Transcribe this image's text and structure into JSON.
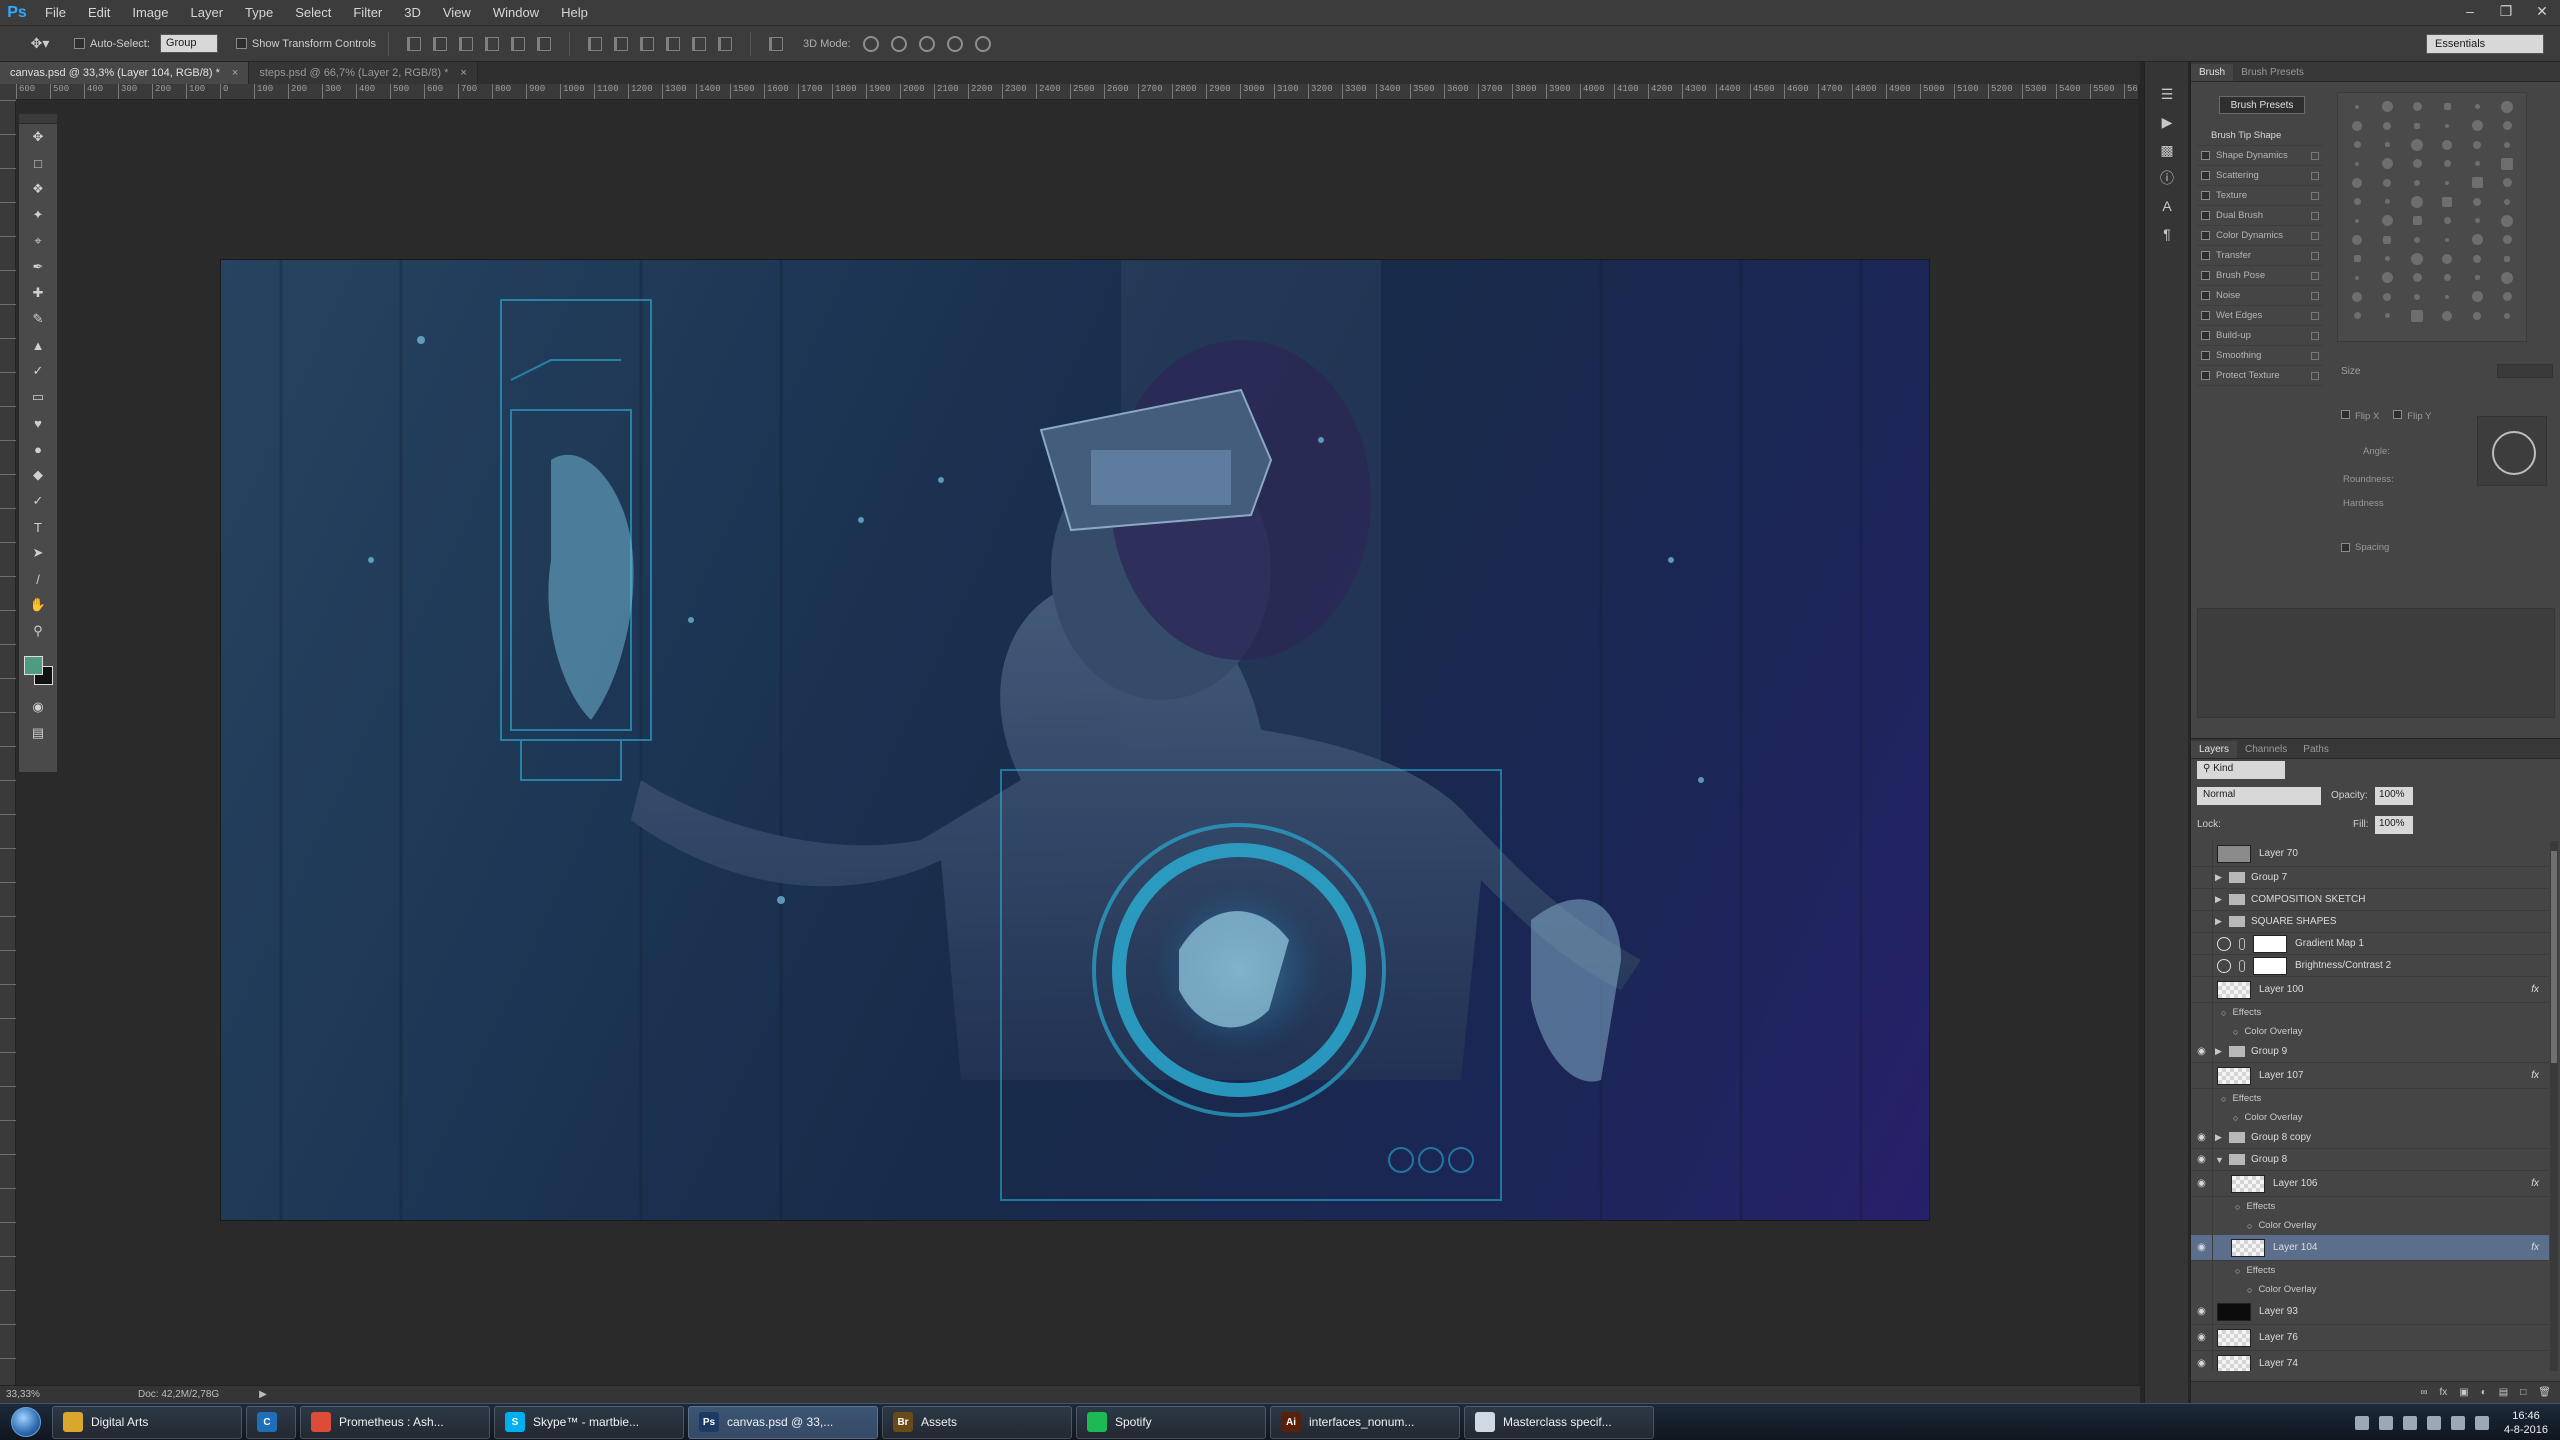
{
  "app": {
    "logo_text": "Ps",
    "menu": [
      "File",
      "Edit",
      "Image",
      "Layer",
      "Type",
      "Select",
      "Filter",
      "3D",
      "View",
      "Window",
      "Help"
    ]
  },
  "window_controls": [
    "minimize-icon",
    "restore-icon",
    "close-icon"
  ],
  "options_bar": {
    "auto_select_label": "Auto-Select:",
    "auto_select_value": "Group",
    "show_transform_label": "Show Transform Controls",
    "mode3d_label": "3D Mode:",
    "workspace": "Essentials"
  },
  "doc_tabs": [
    {
      "label": "canvas.psd @ 33,3% (Layer 104, RGB/8) *",
      "active": true
    },
    {
      "label": "steps.psd @ 66,7% (Layer 2, RGB/8) *",
      "active": false
    }
  ],
  "ruler": {
    "h_ticks": [
      "600",
      "500",
      "400",
      "300",
      "200",
      "100",
      "0",
      "100",
      "200",
      "300",
      "400",
      "500",
      "600",
      "700",
      "800",
      "900",
      "1000",
      "1100",
      "1200",
      "1300",
      "1400",
      "1500",
      "1600",
      "1700",
      "1800",
      "1900",
      "2000",
      "2100",
      "2200",
      "2300",
      "2400",
      "2500",
      "2600",
      "2700",
      "2800",
      "2900",
      "3000",
      "3100",
      "3200",
      "3300",
      "3400",
      "3500",
      "3600",
      "3700",
      "3800",
      "3900",
      "4000",
      "4100",
      "4200",
      "4300",
      "4400",
      "4500",
      "4600",
      "4700",
      "4800",
      "4900",
      "5000",
      "5100",
      "5200",
      "5300",
      "5400",
      "5500",
      "5600"
    ]
  },
  "status": {
    "zoom": "33,33%",
    "doc": "Doc: 42,2M/2,78G"
  },
  "brush_panel": {
    "tabs": [
      "Brush",
      "Brush Presets"
    ],
    "presets_button": "Brush Presets",
    "options": [
      "Brush Tip Shape",
      "Shape Dynamics",
      "Scattering",
      "Texture",
      "Dual Brush",
      "Color Dynamics",
      "Transfer",
      "Brush Pose",
      "Noise",
      "Wet Edges",
      "Build-up",
      "Smoothing",
      "Protect Texture"
    ],
    "size_label": "Size",
    "flip_x": "Flip X",
    "flip_y": "Flip Y",
    "angle_label": "Angle:",
    "roundness_label": "Roundness:",
    "hardness_label": "Hardness",
    "spacing_label": "Spacing"
  },
  "layers_panel": {
    "tabs": [
      "Layers",
      "Channels",
      "Paths"
    ],
    "filter": "Kind",
    "blend_mode": "Normal",
    "opacity_label": "Opacity:",
    "opacity_value": "100%",
    "lock_label": "Lock:",
    "fill_label": "Fill:",
    "fill_value": "100%",
    "layers": [
      {
        "name": "Layer 70",
        "kind": "layer",
        "visible": false,
        "thumb": "gray"
      },
      {
        "name": "Group 7",
        "kind": "group",
        "visible": false
      },
      {
        "name": "COMPOSITION SKETCH",
        "kind": "group",
        "visible": false
      },
      {
        "name": "SQUARE SHAPES",
        "kind": "group",
        "visible": false
      },
      {
        "name": "Gradient Map 1",
        "kind": "adjustment",
        "visible": false
      },
      {
        "name": "Brightness/Contrast 2",
        "kind": "adjustment",
        "visible": false
      },
      {
        "name": "Layer 100",
        "kind": "layer",
        "visible": false,
        "thumb": "checker",
        "fx": true
      },
      {
        "name": "Effects",
        "kind": "sub"
      },
      {
        "name": "Color Overlay",
        "kind": "sub2"
      },
      {
        "name": "Group 9",
        "kind": "group",
        "visible": true
      },
      {
        "name": "Layer 107",
        "kind": "layer",
        "visible": false,
        "thumb": "checker",
        "fx": true
      },
      {
        "name": "Effects",
        "kind": "sub"
      },
      {
        "name": "Color Overlay",
        "kind": "sub2"
      },
      {
        "name": "Group 8 copy",
        "kind": "group",
        "visible": true
      },
      {
        "name": "Group 8",
        "kind": "group-open",
        "visible": true
      },
      {
        "name": "Layer 106",
        "kind": "layer-indent",
        "visible": true,
        "thumb": "checker",
        "fx": true
      },
      {
        "name": "Effects",
        "kind": "sub-indent"
      },
      {
        "name": "Color Overlay",
        "kind": "sub2-indent"
      },
      {
        "name": "Layer 104",
        "kind": "layer-indent",
        "visible": true,
        "thumb": "checker",
        "fx": true,
        "selected": true
      },
      {
        "name": "Effects",
        "kind": "sub-indent"
      },
      {
        "name": "Color Overlay",
        "kind": "sub2-indent"
      },
      {
        "name": "Layer 93",
        "kind": "layer",
        "visible": true,
        "thumb": "dark"
      },
      {
        "name": "Layer 76",
        "kind": "layer",
        "visible": true,
        "thumb": "checker"
      },
      {
        "name": "Layer 74",
        "kind": "layer",
        "visible": true,
        "thumb": "checker"
      }
    ]
  },
  "taskbar": {
    "items": [
      {
        "label": "Digital Arts",
        "icon_color": "#d9a72b",
        "icon_text": ""
      },
      {
        "label": "",
        "icon_color": "#1f6fb8",
        "icon_text": "C"
      },
      {
        "label": "Prometheus : Ash...",
        "icon_color": "#dd4b39",
        "icon_text": ""
      },
      {
        "label": "Skype™ - martbie...",
        "icon_color": "#00aff0",
        "icon_text": "S"
      },
      {
        "label": "canvas.psd @ 33,...",
        "icon_color": "#1c3a63",
        "icon_text": "Ps",
        "active": true
      },
      {
        "label": "Assets",
        "icon_color": "#6b4a1a",
        "icon_text": "Br"
      },
      {
        "label": "Spotify",
        "icon_color": "#1db954",
        "icon_text": ""
      },
      {
        "label": "interfaces_nonum...",
        "icon_color": "#5a1f0a",
        "icon_text": "Ai"
      },
      {
        "label": "Masterclass specif...",
        "icon_color": "#cfd8e3",
        "icon_text": ""
      }
    ],
    "clock_time": "16:46",
    "clock_date": "4-8-2016"
  },
  "colors": {
    "foreground": "#4d9b83",
    "background": "#111111",
    "hud_cyan": "#2ec6e6"
  }
}
